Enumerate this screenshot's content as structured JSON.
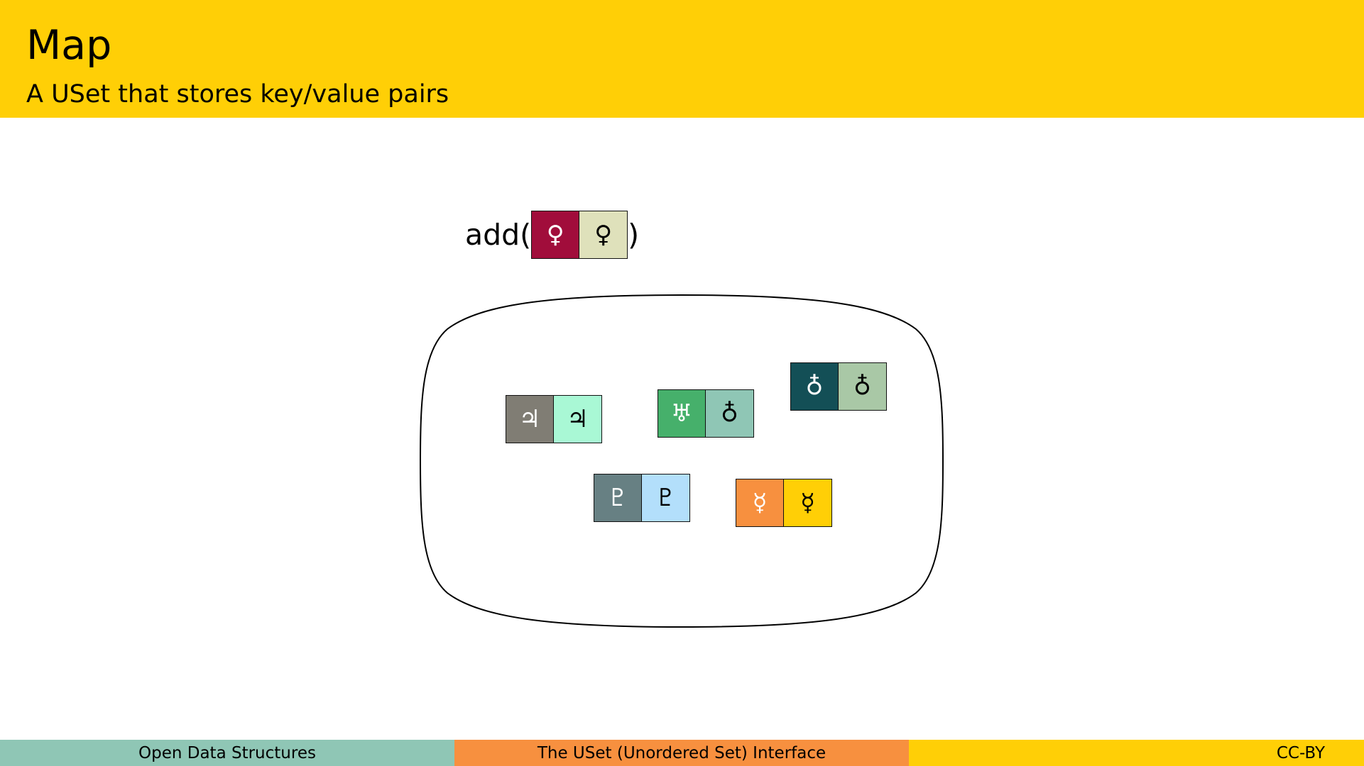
{
  "header": {
    "title": "Map",
    "subtitle": "A USet that stores key/value pairs"
  },
  "operation": {
    "prefix": "add(",
    "suffix": ")",
    "pair": {
      "key_symbol": "♀",
      "value_symbol": "♀",
      "key_color": "#a10d3b",
      "value_color": "#dfe1bb",
      "key_text_color": "#ffffff",
      "value_text_color": "#000000"
    }
  },
  "set": {
    "pairs": [
      {
        "id": "jupiter",
        "key_symbol": "♃",
        "value_symbol": "♃",
        "key_color": "#807d74",
        "value_color": "#a9f8d5",
        "key_text_color": "#ffffff",
        "value_text_color": "#000000"
      },
      {
        "id": "uranus",
        "key_symbol": "♅",
        "value_symbol": "♁",
        "key_color": "#46b06b",
        "value_color": "#8fc6b5",
        "key_text_color": "#ffffff",
        "value_text_color": "#000000"
      },
      {
        "id": "earth",
        "key_symbol": "♁",
        "value_symbol": "♁",
        "key_color": "#134f56",
        "value_color": "#a9c8a6",
        "key_text_color": "#ffffff",
        "value_text_color": "#000000"
      },
      {
        "id": "pluto",
        "key_symbol": "♇",
        "value_symbol": "♇",
        "key_color": "#678083",
        "value_color": "#b3dffb",
        "key_text_color": "#ffffff",
        "value_text_color": "#000000"
      },
      {
        "id": "mercury",
        "key_symbol": "☿",
        "value_symbol": "☿",
        "key_color": "#f7903f",
        "value_color": "#ffcf06",
        "key_text_color": "#ffffff",
        "value_text_color": "#000000"
      }
    ]
  },
  "footer": {
    "left": "Open Data Structures",
    "center": "The USet (Unordered Set) Interface",
    "right": "CC-BY"
  }
}
